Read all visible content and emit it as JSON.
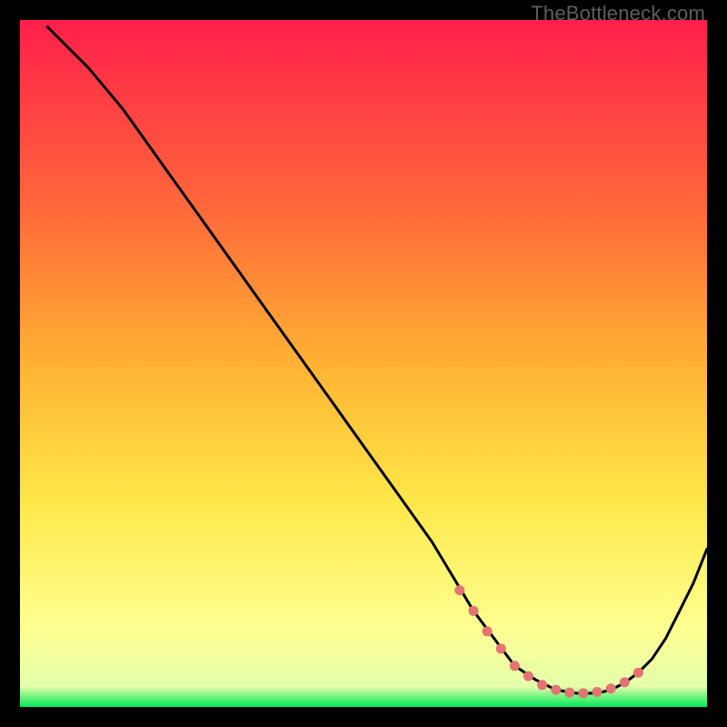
{
  "watermark": "TheBottleneck.com",
  "colors": {
    "gradient_top": "#ff1f4b",
    "gradient_mid1": "#ff6a3a",
    "gradient_mid2": "#ffb233",
    "gradient_mid3": "#ffe749",
    "gradient_mid4": "#ffff8f",
    "gradient_bottom": "#00e756",
    "curve": "#000000",
    "dots": "#e57373"
  },
  "chart_data": {
    "type": "line",
    "title": "",
    "xlabel": "",
    "ylabel": "",
    "xlim": [
      0,
      100
    ],
    "ylim": [
      0,
      100
    ],
    "series": [
      {
        "name": "bottleneck-curve",
        "x": [
          4,
          6,
          10,
          15,
          20,
          25,
          30,
          35,
          40,
          45,
          50,
          55,
          60,
          63,
          66,
          69,
          72,
          75,
          78,
          81,
          84,
          86,
          88,
          90,
          92,
          94,
          96,
          98,
          100
        ],
        "y": [
          99,
          97,
          93,
          87,
          80,
          73,
          66,
          59,
          52,
          45,
          38,
          31,
          24,
          19,
          14,
          10,
          6,
          4,
          2.5,
          2,
          2,
          2.5,
          3.5,
          5,
          7,
          10,
          14,
          18,
          23
        ]
      }
    ],
    "highlight_points": {
      "name": "optimal-zone-dots",
      "x": [
        64,
        66,
        68,
        70,
        72,
        74,
        76,
        78,
        80,
        82,
        84,
        86,
        88,
        90
      ],
      "y": [
        17,
        14,
        11,
        8.5,
        6,
        4.5,
        3.2,
        2.5,
        2.1,
        2.0,
        2.2,
        2.7,
        3.6,
        5.0
      ]
    }
  }
}
